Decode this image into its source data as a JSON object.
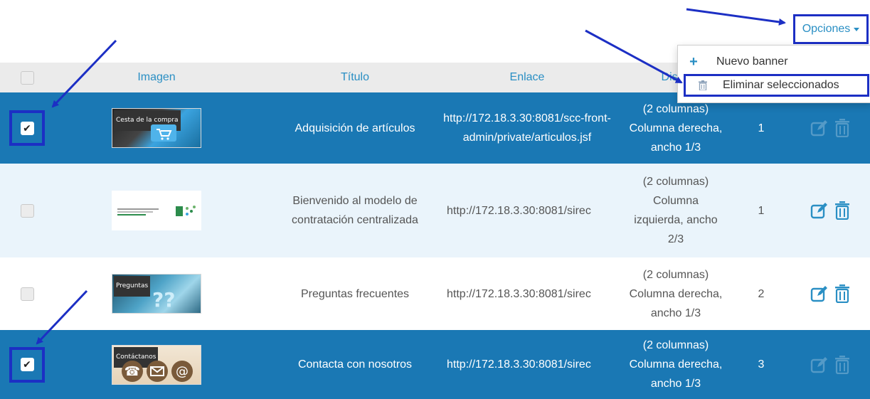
{
  "options": {
    "label": "Opciones"
  },
  "dropdown": {
    "items": [
      {
        "label": "Nuevo banner",
        "icon": "plus-icon"
      },
      {
        "label": "Eliminar seleccionados",
        "icon": "trash-icon"
      }
    ]
  },
  "table": {
    "headers": {
      "image": "Imagen",
      "title": "Título",
      "link": "Enlace",
      "disposition": "Dispo",
      "order": ""
    },
    "rows": [
      {
        "selected": true,
        "image_caption": "Cesta de la compra",
        "title": "Adquisición de artículos",
        "link": "http://172.18.3.30:8081/scc-front-admin/private/articulos.jsf",
        "disposition": "(2 columnas) Columna derecha, ancho 1/3",
        "order": "1"
      },
      {
        "selected": false,
        "image_caption": "",
        "title": "Bienvenido al modelo de contratación centralizada",
        "link": "http://172.18.3.30:8081/sirec",
        "disposition": "(2 columnas) Columna izquierda, ancho 2/3",
        "order": "1"
      },
      {
        "selected": false,
        "image_caption": "Preguntas",
        "title": "Preguntas frecuentes",
        "link": "http://172.18.3.30:8081/sirec",
        "disposition": "(2 columnas) Columna derecha, ancho 1/3",
        "order": "2"
      },
      {
        "selected": true,
        "image_caption": "Contáctanos",
        "title": "Contacta con nosotros",
        "link": "http://172.18.3.30:8081/sirec",
        "disposition": "(2 columnas) Columna derecha, ancho 1/3",
        "order": "3"
      }
    ]
  },
  "colors": {
    "accent": "#2a8fc4",
    "selected_row": "#1a78b4",
    "alt_row": "#eaf4fb",
    "highlight_frame": "#1c2fc4"
  }
}
